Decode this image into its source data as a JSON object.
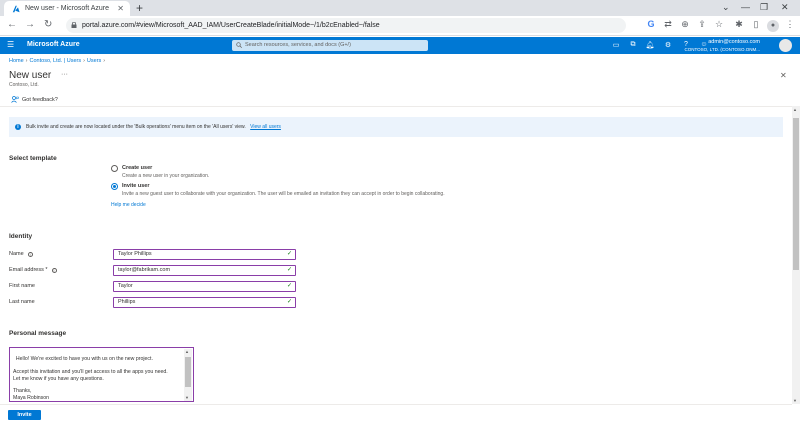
{
  "browser": {
    "tab_title": "New user - Microsoft Azure",
    "url": "portal.azure.com/#view/Microsoft_AAD_IAM/UserCreateBlade/initialMode~/1/b2cEnabled~/false",
    "icons": [
      "back-icon",
      "forward-icon",
      "reload-icon",
      "google-icon",
      "translate-icon",
      "zoom-icon",
      "share-icon",
      "bookmark-star-icon",
      "extensions-icon",
      "sidepanel-icon",
      "profile-icon",
      "menu-icon"
    ]
  },
  "azure": {
    "brand": "Microsoft Azure",
    "search_placeholder": "Search resources, services, and docs (G+/)",
    "user_email": "admin@contoso.com",
    "user_tenant": "CONTOSO, LTD. (CONTOSO.ONM..."
  },
  "breadcrumb": [
    "Home",
    "Contoso, Ltd. | Users",
    "Users"
  ],
  "page": {
    "title": "New user",
    "ellipsis": "···",
    "subtitle": "Contoso, Ltd.",
    "feedback": "Got feedback?"
  },
  "info": {
    "text": "Bulk invite and create are now located under the 'Bulk operations' menu item on the 'All users' view.",
    "link": "View all users"
  },
  "template": {
    "section_title": "Select template",
    "options": [
      {
        "label": "Create user",
        "desc": "Create a new user in your organization.",
        "checked": false
      },
      {
        "label": "Invite user",
        "desc": "Invite a new guest user to collaborate with your organization. The user will be emailed an invitation they can accept in order to begin collaborating.",
        "checked": true
      }
    ],
    "help_link": "Help me decide"
  },
  "identity": {
    "section_title": "Identity",
    "fields": [
      {
        "label": "Name",
        "value": "Taylor Phillips",
        "info": true
      },
      {
        "label": "Email address *",
        "value": "taylor@fabrikam.com",
        "info": true
      },
      {
        "label": "First name",
        "value": "Taylor",
        "info": false
      },
      {
        "label": "Last name",
        "value": "Phillips",
        "info": false
      }
    ]
  },
  "personal_message": {
    "section_title": "Personal message",
    "text": "Hello! We're excited to have you with us on the new project.\n\nAccept this invitation and you'll get access to all the apps you need.\nLet me know if you have any questions.\n\nThanks,\nMaya Robinson"
  },
  "footer": {
    "invite_label": "Invite"
  },
  "colors": {
    "azure_blue": "#0078d4",
    "field_border": "#8a3ea8",
    "check_green": "#107c10",
    "info_bg": "#ebf3fc"
  }
}
